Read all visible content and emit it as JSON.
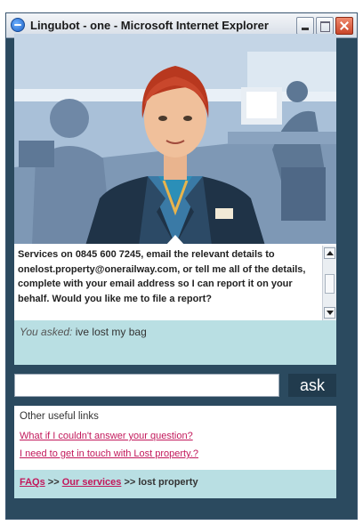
{
  "window": {
    "title": "Lingubot - one - Microsoft Internet Explorer"
  },
  "bubble": {
    "text": "Services on 0845 600 7245, email the relevant details to onelost.property@onerailway.com, or tell me all of the details, complete with your email address so I can report it on your behalf. Would you like me to file a report?"
  },
  "asked": {
    "label": "You asked:",
    "text": "ive lost my bag"
  },
  "ask": {
    "input_value": "",
    "button_label": "ask"
  },
  "links": {
    "title": "Other useful links",
    "items": [
      {
        "label": "What if I couldn't answer your question?"
      },
      {
        "label": "I need to get in touch with Lost property.?"
      }
    ]
  },
  "breadcrumb": {
    "items": [
      {
        "label": "FAQs"
      },
      {
        "label": "Our services"
      }
    ],
    "separator": ">>",
    "current": "lost property"
  },
  "colors": {
    "window_bg": "#2b4a5f",
    "panel_teal": "#b9dfe3",
    "link_pink": "#c2185b",
    "ask_button": "#213b4d"
  }
}
